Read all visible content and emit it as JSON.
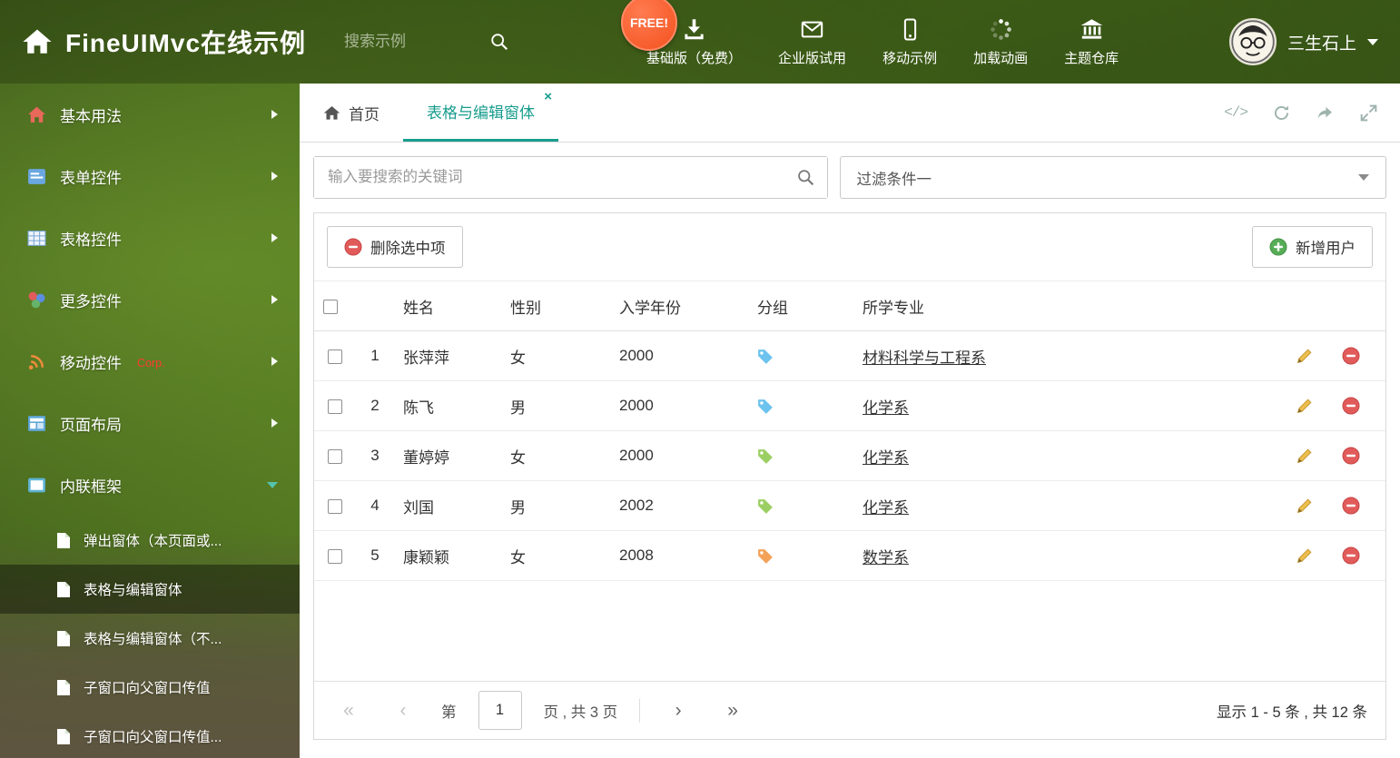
{
  "header": {
    "title": "FineUIMvc在线示例",
    "search_placeholder": "搜索示例",
    "free_badge": "FREE!",
    "nav": [
      {
        "label": "基础版（免费）"
      },
      {
        "label": "企业版试用"
      },
      {
        "label": "移动示例"
      },
      {
        "label": "加载动画"
      },
      {
        "label": "主题仓库"
      }
    ],
    "user_name": "三生石上"
  },
  "sidebar": {
    "items": [
      {
        "label": "基本用法"
      },
      {
        "label": "表单控件"
      },
      {
        "label": "表格控件"
      },
      {
        "label": "更多控件"
      },
      {
        "label": "移动控件",
        "badge": "Corp."
      },
      {
        "label": "页面布局"
      },
      {
        "label": "内联框架"
      }
    ],
    "subitems": [
      {
        "label": "弹出窗体（本页面或..."
      },
      {
        "label": "表格与编辑窗体"
      },
      {
        "label": "表格与编辑窗体（不..."
      },
      {
        "label": "子窗口向父窗口传值"
      },
      {
        "label": "子窗口向父窗口传值..."
      }
    ]
  },
  "tabs": {
    "home": "首页",
    "active": "表格与编辑窗体"
  },
  "icons": {
    "close": "×",
    "code": "</>"
  },
  "content": {
    "search_placeholder": "输入要搜索的关键词",
    "filter_value": "过滤条件一",
    "delete_selected": "删除选中项",
    "add_user": "新增用户"
  },
  "table": {
    "headers": {
      "name": "姓名",
      "gender": "性别",
      "year": "入学年份",
      "group": "分组",
      "major": "所学专业"
    },
    "rows": [
      {
        "num": "1",
        "name": "张萍萍",
        "gender": "女",
        "year": "2000",
        "tag_color": "#6cc3ee",
        "major": "材料科学与工程系"
      },
      {
        "num": "2",
        "name": "陈飞",
        "gender": "男",
        "year": "2000",
        "tag_color": "#6cc3ee",
        "major": "化学系"
      },
      {
        "num": "3",
        "name": "董婷婷",
        "gender": "女",
        "year": "2000",
        "tag_color": "#9ccf63",
        "major": "化学系"
      },
      {
        "num": "4",
        "name": "刘国",
        "gender": "男",
        "year": "2002",
        "tag_color": "#9ccf63",
        "major": "化学系"
      },
      {
        "num": "5",
        "name": "康颖颖",
        "gender": "女",
        "year": "2008",
        "tag_color": "#f4a259",
        "major": "数学系"
      }
    ]
  },
  "pagination": {
    "first": "«",
    "prev": "‹",
    "page_label": "第",
    "page_value": "1",
    "pages_label": "页 , 共 3 页",
    "next": "›",
    "last": "»",
    "summary": "显示 1 - 5 条 , 共 12 条"
  },
  "colors": {
    "accent_teal": "#189d8d",
    "danger_red": "#e25b5b",
    "success_green": "#57ad57",
    "badge_orange": "#f4511e"
  }
}
